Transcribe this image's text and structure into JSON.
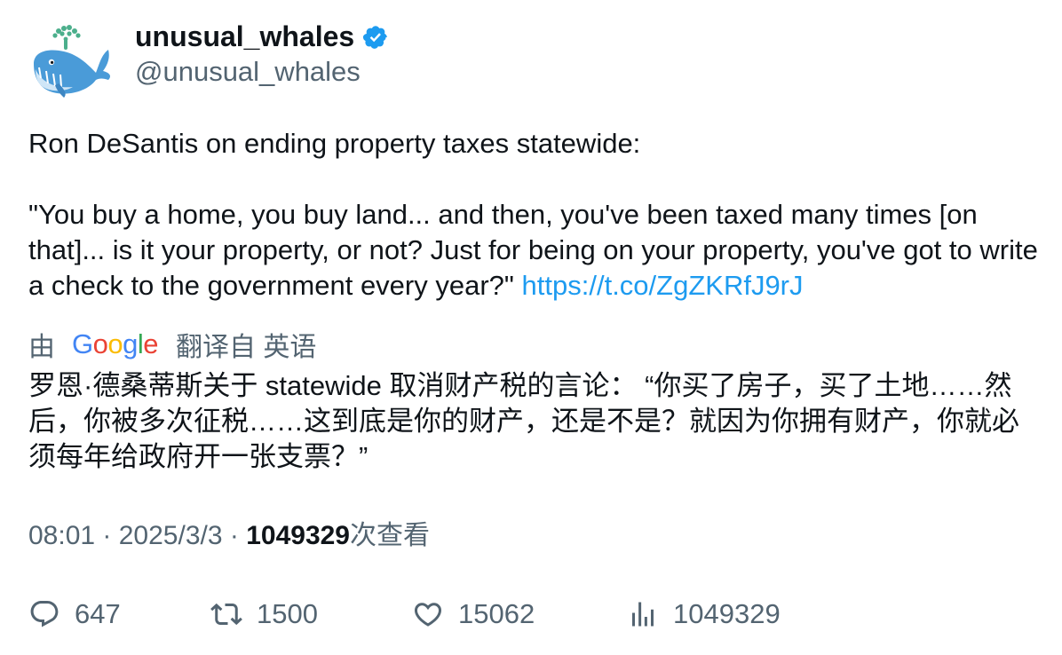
{
  "author": {
    "display_name": "unusual_whales",
    "handle": "@unusual_whales",
    "avatar_icon": "whale-logo-icon",
    "verified_icon": "verified-badge-icon"
  },
  "tweet": {
    "line1": "Ron DeSantis on ending property taxes statewide:",
    "quote": "\"You buy a home, you buy land... and then, you've been taxed many times [on that]... is it your property, or not? Just for being on your property, you've got to write a check to the government every year?\"",
    "link": "https://t.co/ZgZKRfJ9rJ"
  },
  "translation": {
    "prefix": "由",
    "provider": "Google",
    "suffix": "翻译自 英语",
    "text": "罗恩·德桑蒂斯关于 statewide 取消财产税的言论： “你买了房子，买了土地……然后，你被多次征税……这到底是你的财产，还是不是？就因为你拥有财产，你就必须每年给政府开一张支票？”"
  },
  "meta": {
    "time": "08:01",
    "separator": " · ",
    "date": "2025/3/3",
    "views": "1049329",
    "views_label": "次查看"
  },
  "actions": {
    "replies": "647",
    "retweets": "1500",
    "likes": "15062",
    "views": "1049329"
  },
  "colors": {
    "link": "#1d9bf0",
    "secondary": "#536471",
    "primary": "#0f1419",
    "verified": "#1d9bf0"
  }
}
